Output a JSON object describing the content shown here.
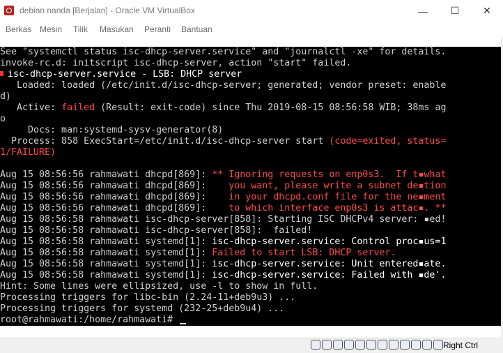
{
  "window": {
    "title": "debian nanda [Berjalan] - Oracle VM VirtualBox",
    "minimize_glyph": "—",
    "maximize_glyph": "☐",
    "close_glyph": "✕"
  },
  "menu": {
    "items": [
      "Berkas",
      "Mesin",
      "Tilik",
      "Masukan",
      "Peranti",
      "Bantuan"
    ]
  },
  "terminal": {
    "lines": [
      {
        "segs": [
          {
            "t": "See \"systemctl status isc-dhcp-server.service\" and \"journalctl -xe\" for details."
          }
        ]
      },
      {
        "segs": [
          {
            "t": "invoke-rc.d: initscript isc-dhcp-server, action \"start\" failed."
          }
        ]
      },
      {
        "bullet": true,
        "segs": [
          {
            "t": "isc-dhcp-server.service - LSB: DHCP server",
            "c": "white"
          }
        ]
      },
      {
        "segs": [
          {
            "t": "   Loaded: loaded (/etc/init.d/isc-dhcp-server; generated; vendor preset: enable"
          }
        ]
      },
      {
        "segs": [
          {
            "t": "d)"
          }
        ]
      },
      {
        "segs": [
          {
            "t": "   Active: "
          },
          {
            "t": "failed",
            "c": "red"
          },
          {
            "t": " (Result: exit-code) since Thu 2019-08-15 08:56:58 WIB; 38ms ag"
          }
        ]
      },
      {
        "segs": [
          {
            "t": "o"
          }
        ]
      },
      {
        "segs": [
          {
            "t": "     Docs: man:systemd-sysv-generator(8)"
          }
        ]
      },
      {
        "segs": [
          {
            "t": "  Process: 858 ExecStart=/etc/init.d/isc-dhcp-server start "
          },
          {
            "t": "(code=exited, status=",
            "c": "red"
          }
        ]
      },
      {
        "segs": [
          {
            "t": "1/FAILURE)",
            "c": "red"
          }
        ]
      },
      {
        "segs": [
          {
            "t": ""
          }
        ]
      },
      {
        "segs": [
          {
            "t": "Aug 15 08:56:56 rahmawati dhcpd[869]: "
          },
          {
            "t": "** Ignoring requests on enp0s3.  If t▪what",
            "c": "red"
          }
        ]
      },
      {
        "segs": [
          {
            "t": "Aug 15 08:56:56 rahmawati dhcpd[869]: "
          },
          {
            "t": "   you want, please write a subnet de▪tion",
            "c": "red"
          }
        ]
      },
      {
        "segs": [
          {
            "t": "Aug 15 08:56:56 rahmawati dhcpd[869]: "
          },
          {
            "t": "   in your dhcpd.conf file for the ne▪ment",
            "c": "red"
          }
        ]
      },
      {
        "segs": [
          {
            "t": "Aug 15 08:56:56 rahmawati dhcpd[869]: "
          },
          {
            "t": "   to which interface enp0s3 is attac▪. **",
            "c": "red"
          }
        ]
      },
      {
        "segs": [
          {
            "t": "Aug 15 08:56:58 rahmawati isc-dhcp-server[858]: Starting ISC DHCPv4 server: ▪ed!"
          }
        ]
      },
      {
        "segs": [
          {
            "t": "Aug 15 08:56:58 rahmawati isc-dhcp-server[858]:  failed!"
          }
        ]
      },
      {
        "segs": [
          {
            "t": "Aug 15 08:56:58 rahmawati systemd[1]: "
          },
          {
            "t": "isc-dhcp-server.service: Control proc▪us=1",
            "c": "white"
          }
        ]
      },
      {
        "segs": [
          {
            "t": "Aug 15 08:56:58 rahmawati systemd[1]: "
          },
          {
            "t": "Failed to start LSB: DHCP server.",
            "c": "red"
          }
        ]
      },
      {
        "segs": [
          {
            "t": "Aug 15 08:56:58 rahmawati systemd[1]: "
          },
          {
            "t": "isc-dhcp-server.service: Unit entered▪ate.",
            "c": "white"
          }
        ]
      },
      {
        "segs": [
          {
            "t": "Aug 15 08:56:58 rahmawati systemd[1]: "
          },
          {
            "t": "isc-dhcp-server.service: Failed with ▪de'.",
            "c": "white"
          }
        ]
      },
      {
        "segs": [
          {
            "t": "Hint: Some lines were ellipsized, use -l to show in full."
          }
        ]
      },
      {
        "segs": [
          {
            "t": "Processing triggers for libc-bin (2.24-11+deb9u3) ..."
          }
        ]
      },
      {
        "segs": [
          {
            "t": "Processing triggers for systemd (232-25+deb9u4) ..."
          }
        ]
      },
      {
        "segs": [
          {
            "t": "root@rahmawati:/home/rahmawati# "
          }
        ],
        "cursor": true
      }
    ]
  },
  "statusbar": {
    "icons": [
      "hard-disk-icon",
      "optical-drive-icon",
      "audio-icon",
      "network-icon",
      "usb-icon",
      "shared-folder-icon",
      "display-icon",
      "video-capture-icon",
      "recording-icon",
      "cpu-icon",
      "mouse-integration-icon",
      "keyboard-icon"
    ],
    "host_key_label": "Right Ctrl"
  }
}
